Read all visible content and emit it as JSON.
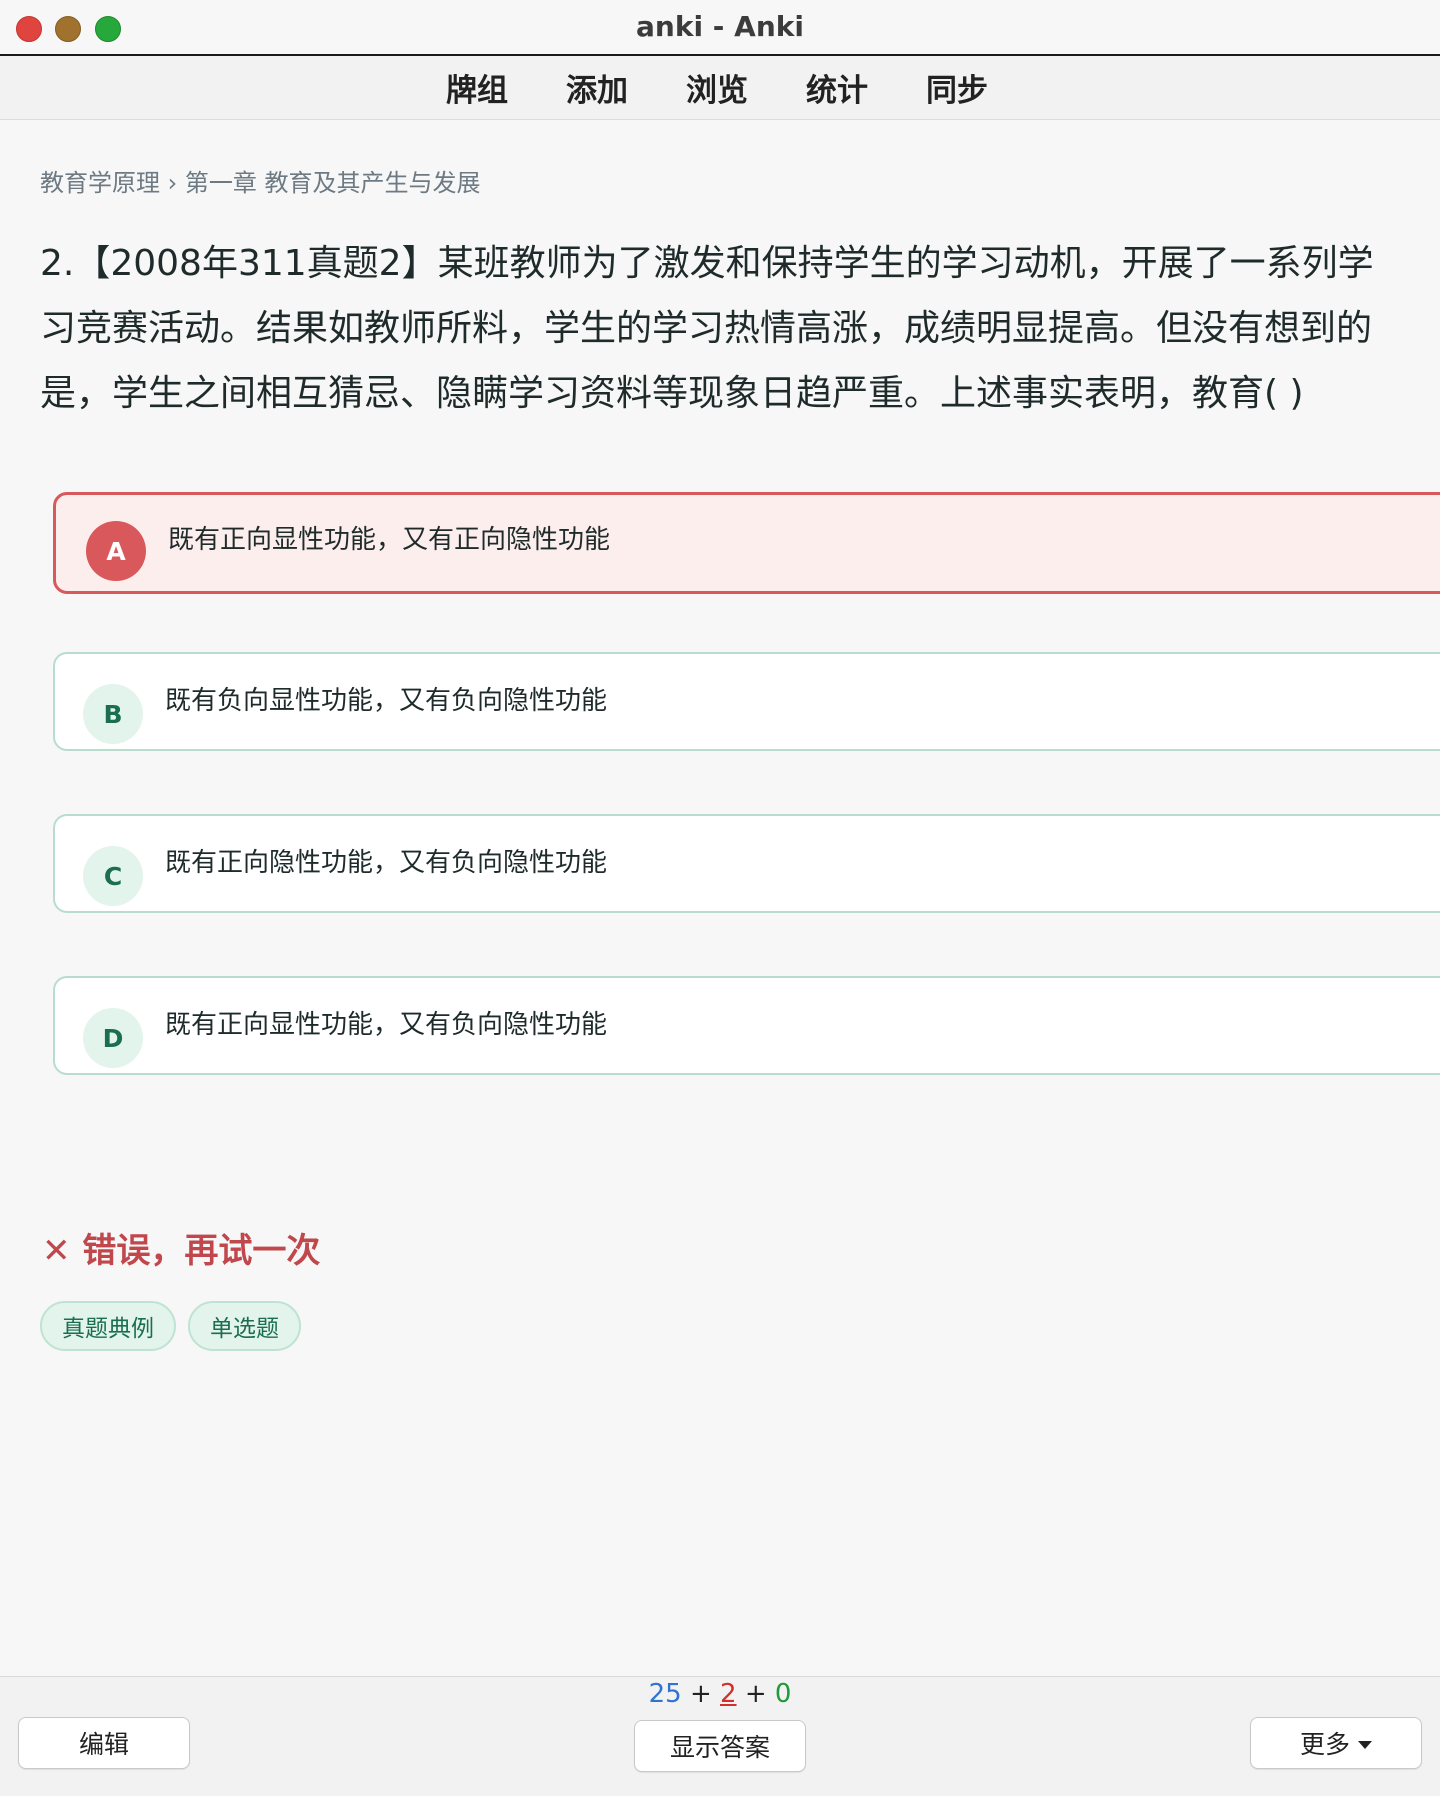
{
  "window": {
    "title": "anki - Anki"
  },
  "toolbar": {
    "items": [
      "牌组",
      "添加",
      "浏览",
      "统计",
      "同步"
    ]
  },
  "card": {
    "breadcrumb": "教育学原理 › 第一章 教育及其产生与发展",
    "question": "2.【2008年311真题2】某班教师为了激发和保持学生的学习动机，开展了一系列学习竞赛活动。结果如教师所料，学生的学习热情高涨，成绩明显提高。但没有想到的是，学生之间相互猜忌、隐瞒学习资料等现象日趋严重。上述事实表明，教育( )",
    "options": [
      {
        "letter": "A",
        "text": "既有正向显性功能，又有正向隐性功能",
        "state": "wrong"
      },
      {
        "letter": "B",
        "text": "既有负向显性功能，又有负向隐性功能",
        "state": "normal"
      },
      {
        "letter": "C",
        "text": "既有正向隐性功能，又有负向隐性功能",
        "state": "normal"
      },
      {
        "letter": "D",
        "text": "既有正向显性功能，又有负向隐性功能",
        "state": "normal"
      }
    ],
    "feedback": {
      "icon": "✕",
      "text": "错误，再试一次"
    },
    "tags": [
      "真题典例",
      "单选题"
    ]
  },
  "bottom": {
    "edit_label": "编辑",
    "show_answer_label": "显示答案",
    "more_label": "更多",
    "counts": {
      "new": "25",
      "learn": "2",
      "review": "0",
      "sep": "+"
    }
  },
  "colors": {
    "accent_green": "#1b6e52",
    "wrong_red": "#d9585b",
    "new_blue": "#2f74d0",
    "learn_red": "#d32f2f",
    "review_green": "#1e9a3a"
  }
}
